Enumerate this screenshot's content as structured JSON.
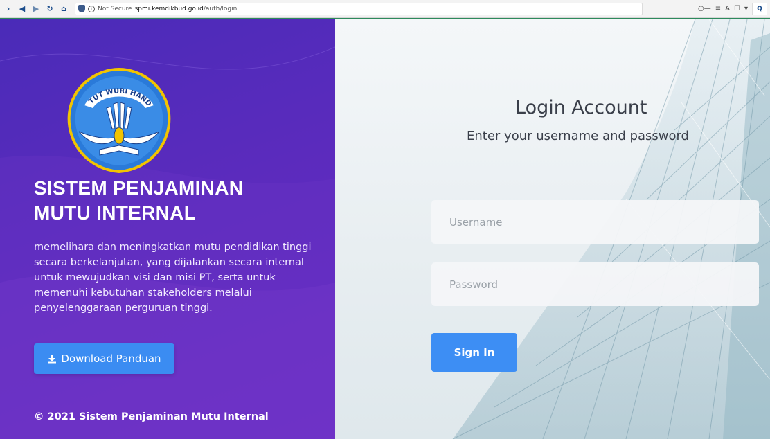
{
  "browser": {
    "not_secure": "Not Secure",
    "url_host": "spmi.kemdikbud.go.id",
    "url_path": "/auth/login",
    "search_label": "Q"
  },
  "left": {
    "logo_text": "TUT WURI HANDAYANI",
    "title_line1": "SISTEM PENJAMINAN",
    "title_line2": "MUTU INTERNAL",
    "description": "memelihara dan meningkatkan mutu pendidikan tinggi secara berkelanjutan, yang dijalankan secara internal untuk mewujudkan visi dan misi PT, serta untuk memenuhi kebutuhan stakeholders melalui penyelenggaraan perguruan tinggi.",
    "download_button": "Download Panduan",
    "copyright": "© 2021 Sistem Penjaminan Mutu Internal"
  },
  "login": {
    "heading": "Login Account",
    "subheading": "Enter your username and password",
    "username_placeholder": "Username",
    "password_placeholder": "Password",
    "signin_button": "Sign In"
  },
  "colors": {
    "left_panel": "#5b2bbd",
    "button_blue": "#3b8cf2",
    "chrome_accent": "#2d8a5c"
  }
}
